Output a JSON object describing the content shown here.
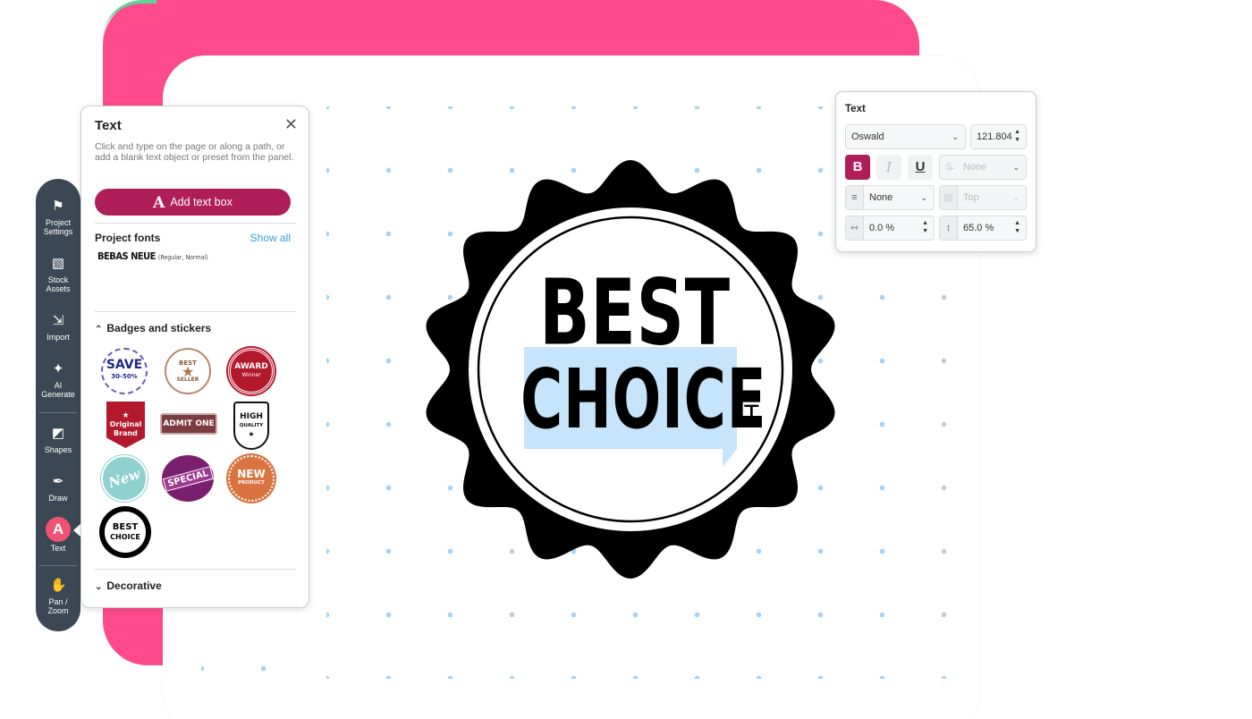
{
  "toolbar": {
    "items": [
      {
        "id": "project-settings",
        "label_line1": "Project",
        "label_line2": "Settings",
        "icon": "flag-icon"
      },
      {
        "id": "stock-assets",
        "label_line1": "Stock",
        "label_line2": "Assets",
        "icon": "image-icon"
      },
      {
        "id": "import",
        "label_line1": "Import",
        "label_line2": "",
        "icon": "import-icon"
      },
      {
        "id": "ai-generate",
        "label_line1": "AI",
        "label_line2": "Generate",
        "icon": "sparkle-icon"
      },
      {
        "id": "shapes",
        "label_line1": "Shapes",
        "label_line2": "",
        "icon": "shapes-icon"
      },
      {
        "id": "draw",
        "label_line1": "Draw",
        "label_line2": "",
        "icon": "pen-icon"
      },
      {
        "id": "text",
        "label_line1": "Text",
        "label_line2": "",
        "icon": "text-icon",
        "active_letter": "A"
      },
      {
        "id": "pan-zoom",
        "label_line1": "Pan /",
        "label_line2": "Zoom",
        "icon": "hand-icon"
      }
    ]
  },
  "text_panel": {
    "title": "Text",
    "description": "Click and type on the page or along a path, or add a blank text object or preset from the panel.",
    "add_button_icon": "A",
    "add_button_label": "Add text box",
    "project_fonts_label": "Project fonts",
    "show_all_label": "Show all",
    "font_name": "BEBAS NEUE",
    "font_variant": "(Regular, Normal)",
    "badges_label": "Badges and stickers",
    "decorative_label": "Decorative",
    "stickers": [
      {
        "line1": "SAVE",
        "line2": "30-50%"
      },
      {
        "line1": "BEST",
        "line2": "SELLER"
      },
      {
        "line1": "AWARD",
        "line2": "Winner"
      },
      {
        "line1": "Original",
        "line2": "Brand"
      },
      {
        "line1": "ADMIT ONE",
        "line2": ""
      },
      {
        "line1": "HIGH",
        "line2": "QUALITY"
      },
      {
        "line1": "New",
        "line2": ""
      },
      {
        "line1": "SPECIAL",
        "line2": ""
      },
      {
        "line1": "NEW",
        "line2": "PRODUCT"
      },
      {
        "line1": "BEST",
        "line2": "CHOICE"
      }
    ]
  },
  "canvas": {
    "badge_line1": "BEST",
    "badge_line2": "CHOICE"
  },
  "props_panel": {
    "title": "Text",
    "font_family": "Oswald",
    "font_size": "121.804",
    "bold": "B",
    "italic": "I",
    "underline": "U",
    "strike_value": "None",
    "align_value": "None",
    "vertical_align_value": "Top",
    "letter_spacing": "0.0 %",
    "line_height": "65.0 %"
  },
  "colors": {
    "accent_pink": "#ff4a8d",
    "button_magenta": "#b01e5a",
    "toolbar_dark": "#3b4754",
    "text_tool_active": "#f05272",
    "link_blue": "#2fa3d8",
    "selection_blue": "#c6e4fb"
  }
}
